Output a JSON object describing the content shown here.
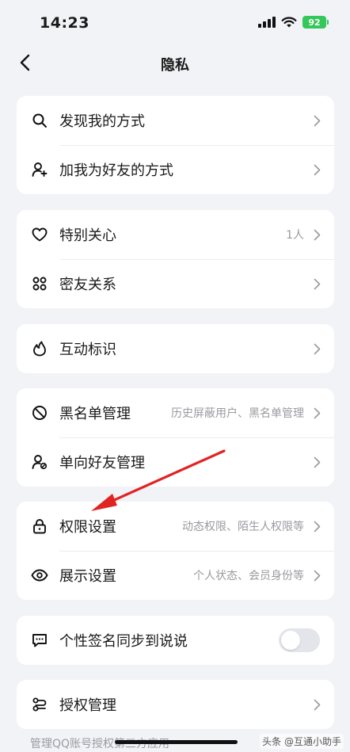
{
  "status_bar": {
    "time": "14:23",
    "battery": "92"
  },
  "nav": {
    "title": "隐私"
  },
  "groups": [
    {
      "rows": [
        {
          "icon": "search-icon",
          "label": "发现我的方式",
          "value": ""
        },
        {
          "icon": "add-friend-icon",
          "label": "加我为好友的方式",
          "value": ""
        }
      ]
    },
    {
      "rows": [
        {
          "icon": "heart-icon",
          "label": "特别关心",
          "value": "1人"
        },
        {
          "icon": "close-friends-icon",
          "label": "密友关系",
          "value": ""
        }
      ]
    },
    {
      "rows": [
        {
          "icon": "flame-icon",
          "label": "互动标识",
          "value": ""
        }
      ]
    },
    {
      "rows": [
        {
          "icon": "block-icon",
          "label": "黑名单管理",
          "value": "历史屏蔽用户、黑名单管理"
        },
        {
          "icon": "one-way-friend-icon",
          "label": "单向好友管理",
          "value": ""
        }
      ]
    },
    {
      "rows": [
        {
          "icon": "lock-icon",
          "label": "权限设置",
          "value": "动态权限、陌生人权限等"
        },
        {
          "icon": "eye-icon",
          "label": "展示设置",
          "value": "个人状态、会员身份等"
        }
      ]
    },
    {
      "rows": [
        {
          "icon": "message-icon",
          "label": "个性签名同步到说说",
          "value": "",
          "toggle": false
        }
      ]
    },
    {
      "rows": [
        {
          "icon": "authorize-icon",
          "label": "授权管理",
          "value": ""
        }
      ]
    }
  ],
  "footnote": "管理QQ账号授权第三方应用",
  "watermark": "头条 @互通小助手",
  "colors": {
    "background": "#f2f3f7",
    "card": "#ffffff",
    "annotation_arrow": "#e02424",
    "battery": "#34c759"
  }
}
